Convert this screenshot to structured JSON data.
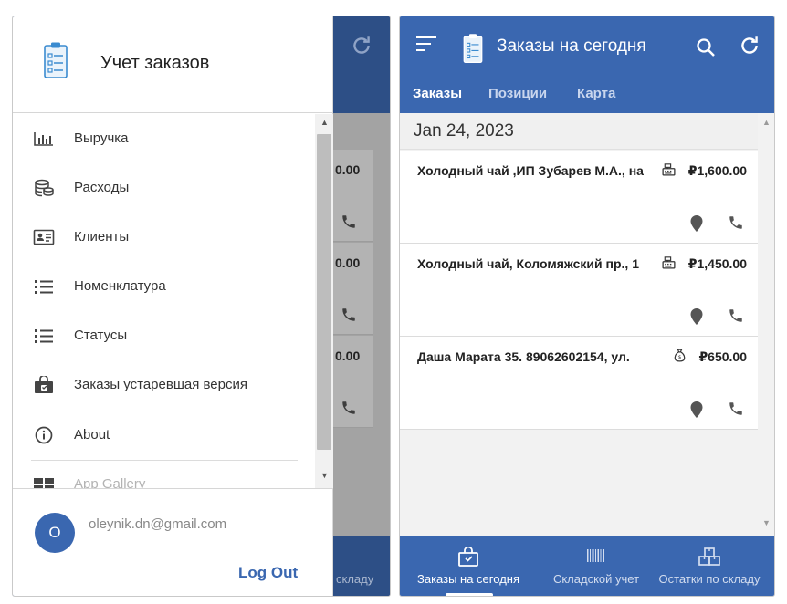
{
  "drawer": {
    "title": "Учет заказов",
    "items": [
      {
        "label": "Выручка",
        "icon": "bar-chart-icon"
      },
      {
        "label": "Расходы",
        "icon": "coins-stack-icon"
      },
      {
        "label": "Клиенты",
        "icon": "contact-card-icon"
      },
      {
        "label": "Номенклатура",
        "icon": "list-icon"
      },
      {
        "label": "Статусы",
        "icon": "list-icon"
      },
      {
        "label": "Заказы устаревшая версия",
        "icon": "shopping-bag-icon"
      },
      {
        "label": "About",
        "icon": "info-icon"
      },
      {
        "label": "App Gallery",
        "icon": "gallery-grid-icon"
      }
    ],
    "user": {
      "avatar_letter": "O",
      "email": "oleynik.dn@gmail.com"
    },
    "logout_label": "Log Out"
  },
  "background_screen": {
    "prices": [
      "0.00",
      "0.00",
      "0.00"
    ],
    "bottom_label": "складу"
  },
  "main": {
    "title": "Заказы на сегодня",
    "tabs": [
      {
        "label": "Заказы",
        "active": true
      },
      {
        "label": "Позиции",
        "active": false
      },
      {
        "label": "Карта",
        "active": false
      }
    ],
    "date_header": "Jan 24, 2023",
    "orders": [
      {
        "text": "Холодный чай ,ИП Зубарев М.А., на",
        "price": "₽1,600.00",
        "payment_icon": "cash-register-icon"
      },
      {
        "text": "Холодный чай, Коломяжский пр., 1",
        "price": "₽1,450.00",
        "payment_icon": "cash-register-icon"
      },
      {
        "text": "Даша Марата 35. 89062602154, ул.",
        "price": "₽650.00",
        "payment_icon": "money-bag-icon"
      }
    ],
    "bottom_nav": [
      {
        "label": "Заказы на сегодня",
        "icon": "shopping-bag-icon",
        "active": true
      },
      {
        "label": "Складской учет",
        "icon": "barcode-icon",
        "active": false
      },
      {
        "label": "Остатки по складу",
        "icon": "boxes-icon",
        "active": false
      }
    ]
  },
  "colors": {
    "primary": "#3a67b0",
    "primary_dimmed": "#2d4f86",
    "scrim": "#9c9c9c"
  }
}
